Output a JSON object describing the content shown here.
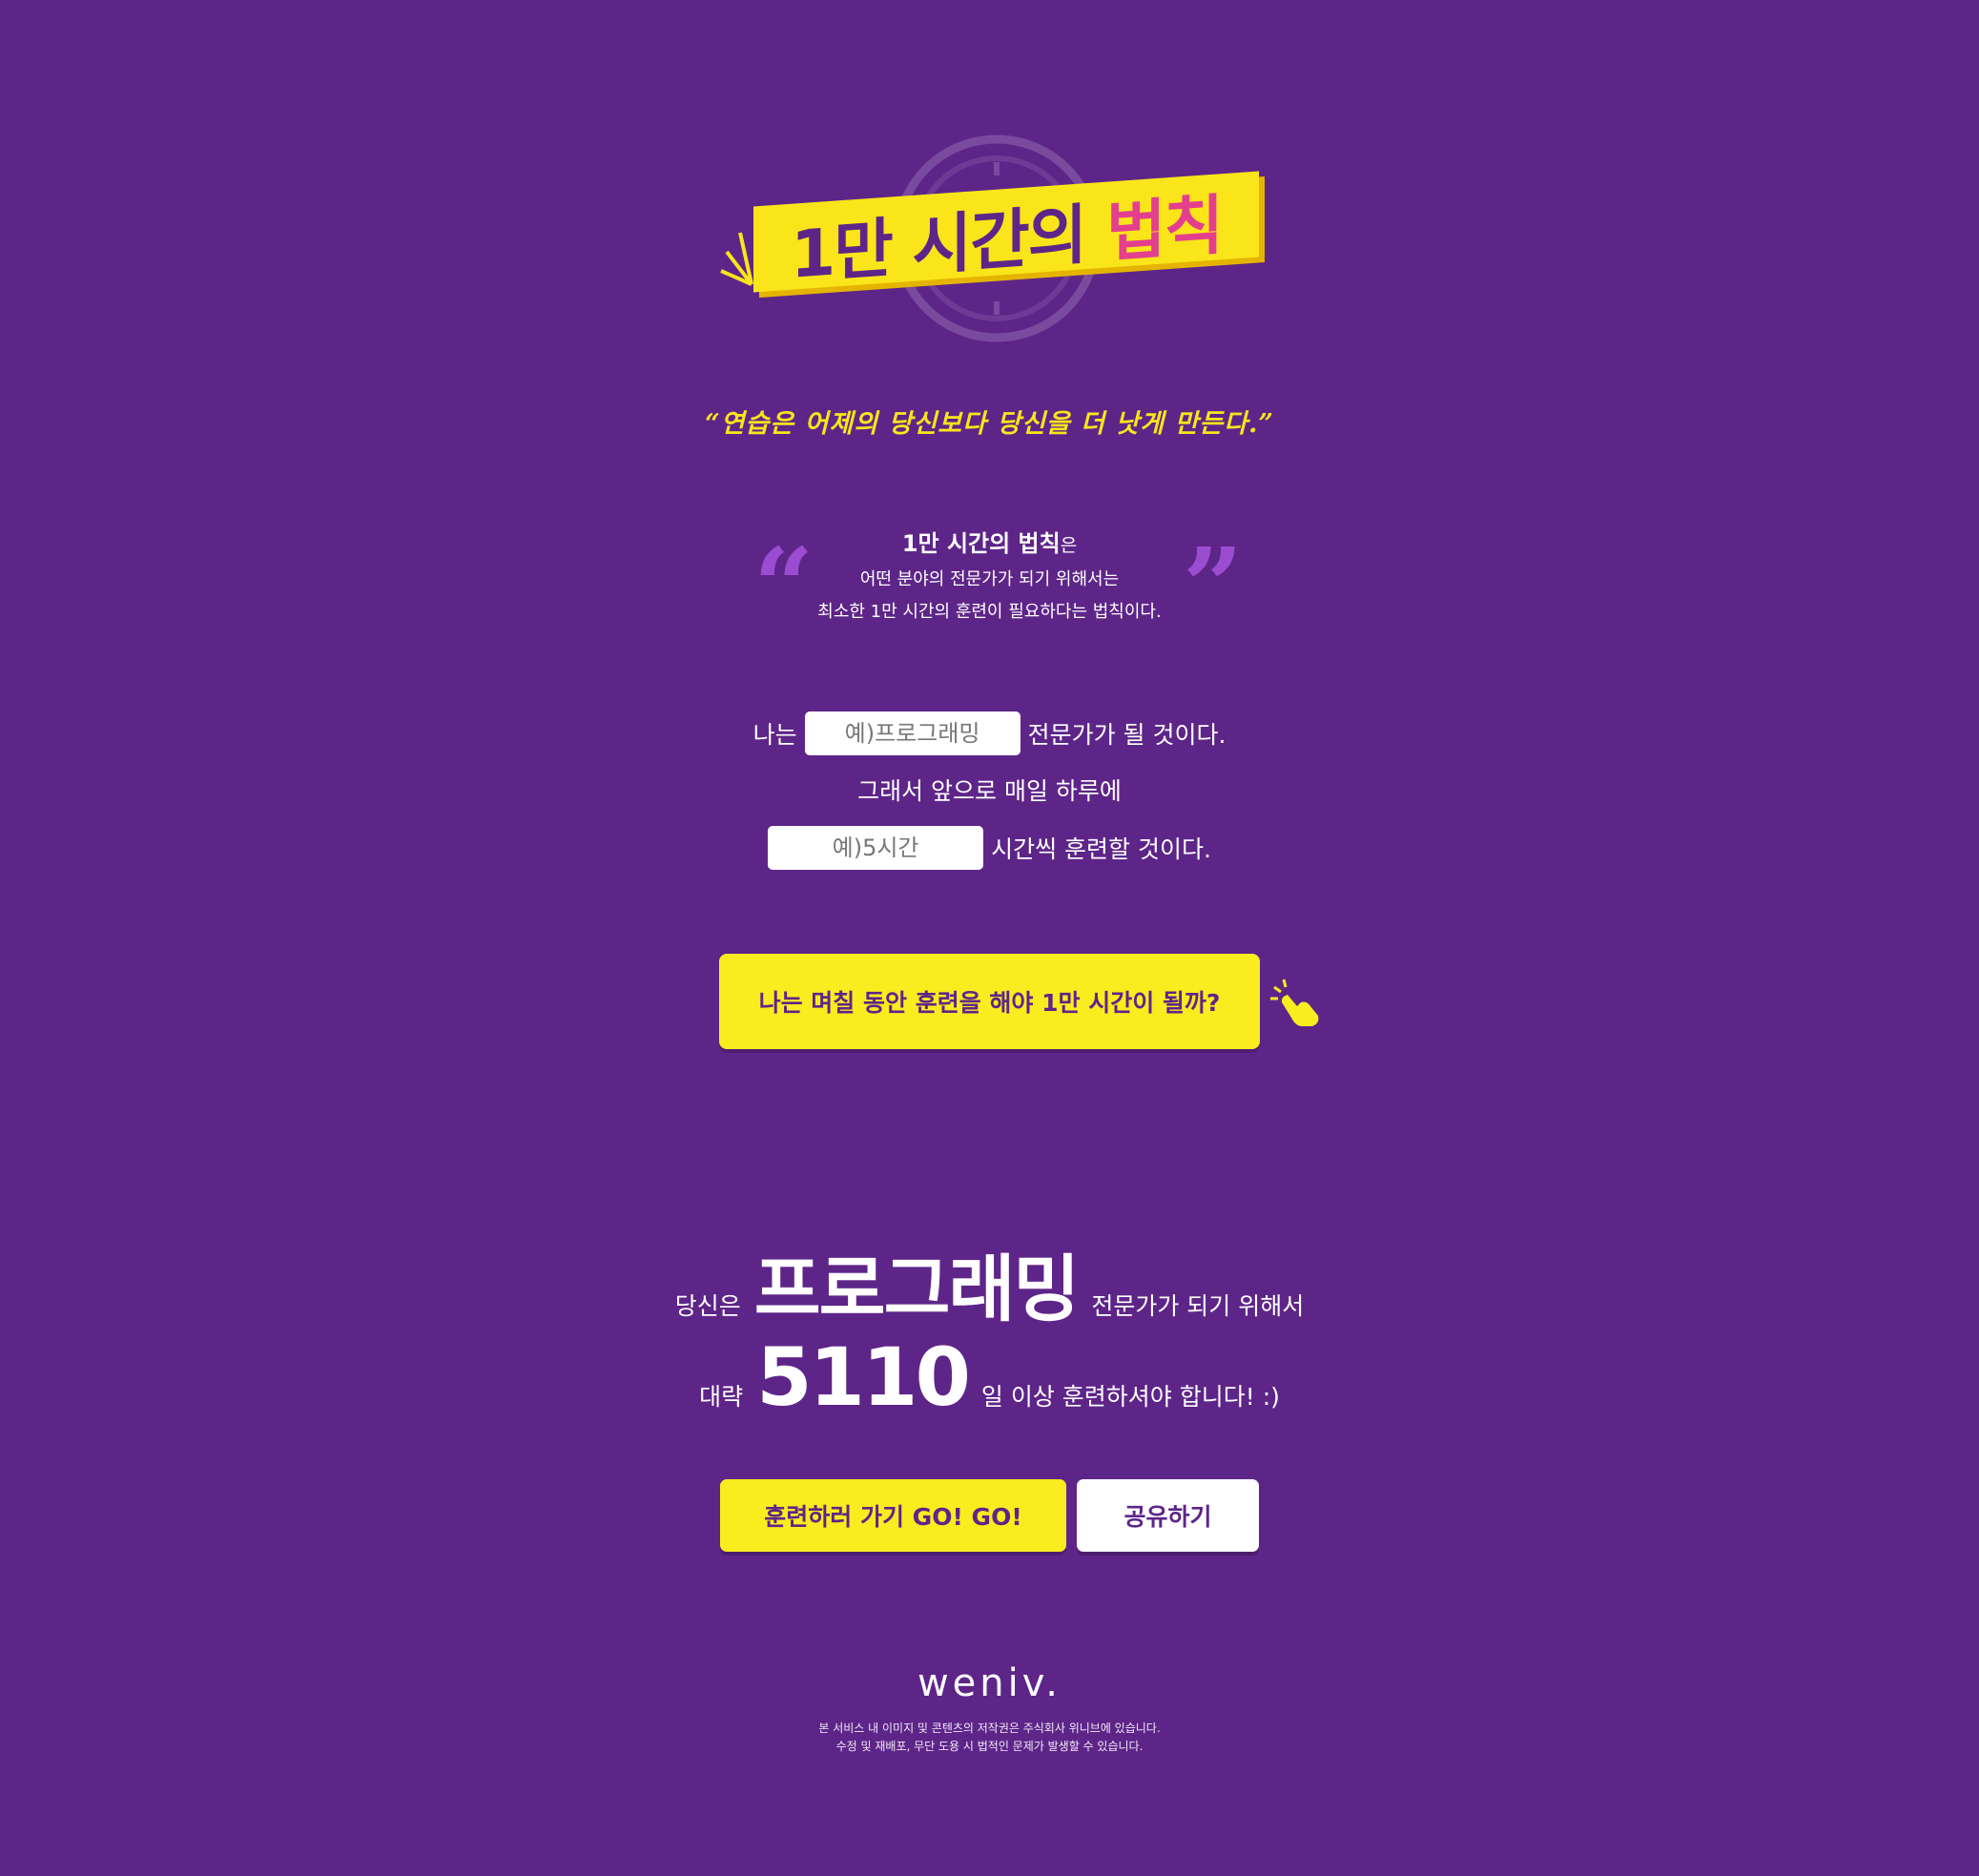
{
  "header": {
    "title_main": "1만 시간의 ",
    "title_accent": "법칙",
    "motto": "“연습은 어제의 당신보다 당신을 더 낫게 만든다.”"
  },
  "definition": {
    "open_quote": "“",
    "close_quote": "”",
    "title": "1만 시간의 법칙",
    "title_suffix": "은",
    "line1": "어떤 분야의 전문가가 되기 위해서는",
    "line2": "최소한 1만 시간의 훈련이 필요하다는 법칙이다."
  },
  "form": {
    "prefix": "나는",
    "field_placeholder": "예)프로그래밍",
    "field_suffix": "전문가가 될 것이다.",
    "middle": "그래서 앞으로 매일 하루에",
    "hours_placeholder": "예)5시간",
    "hours_suffix": "시간씩 훈련할 것이다.",
    "submit_label": "나는 며칠 동안 훈련을 해야 1만 시간이 될까?"
  },
  "result": {
    "prefix": "당신은",
    "field": "프로그래밍",
    "field_suffix": "전문가가 되기 위해서",
    "approx": "대략",
    "days": "5110",
    "days_suffix": "일 이상 훈련하셔야 합니다! :)"
  },
  "actions": {
    "go_label": "훈련하러 가기 GO! GO!",
    "share_label": "공유하기"
  },
  "footer": {
    "logo": "weniv.",
    "line1": "본 서비스 내 이미지 및 콘텐츠의 저작권은 주식회사 위니브에 있습니다.",
    "line2": "수정 및 재배포, 무단 도용 시 법적인 문제가 발생할 수 있습니다."
  },
  "colors": {
    "background": "#5e2589",
    "accent_yellow": "#f9ec1f",
    "accent_pink": "#e43f8e",
    "quote_purple": "#9a4dd0"
  },
  "icons": {
    "clock": "clock-icon",
    "burst": "burst-lines-icon",
    "hand": "pointing-hand-icon"
  }
}
